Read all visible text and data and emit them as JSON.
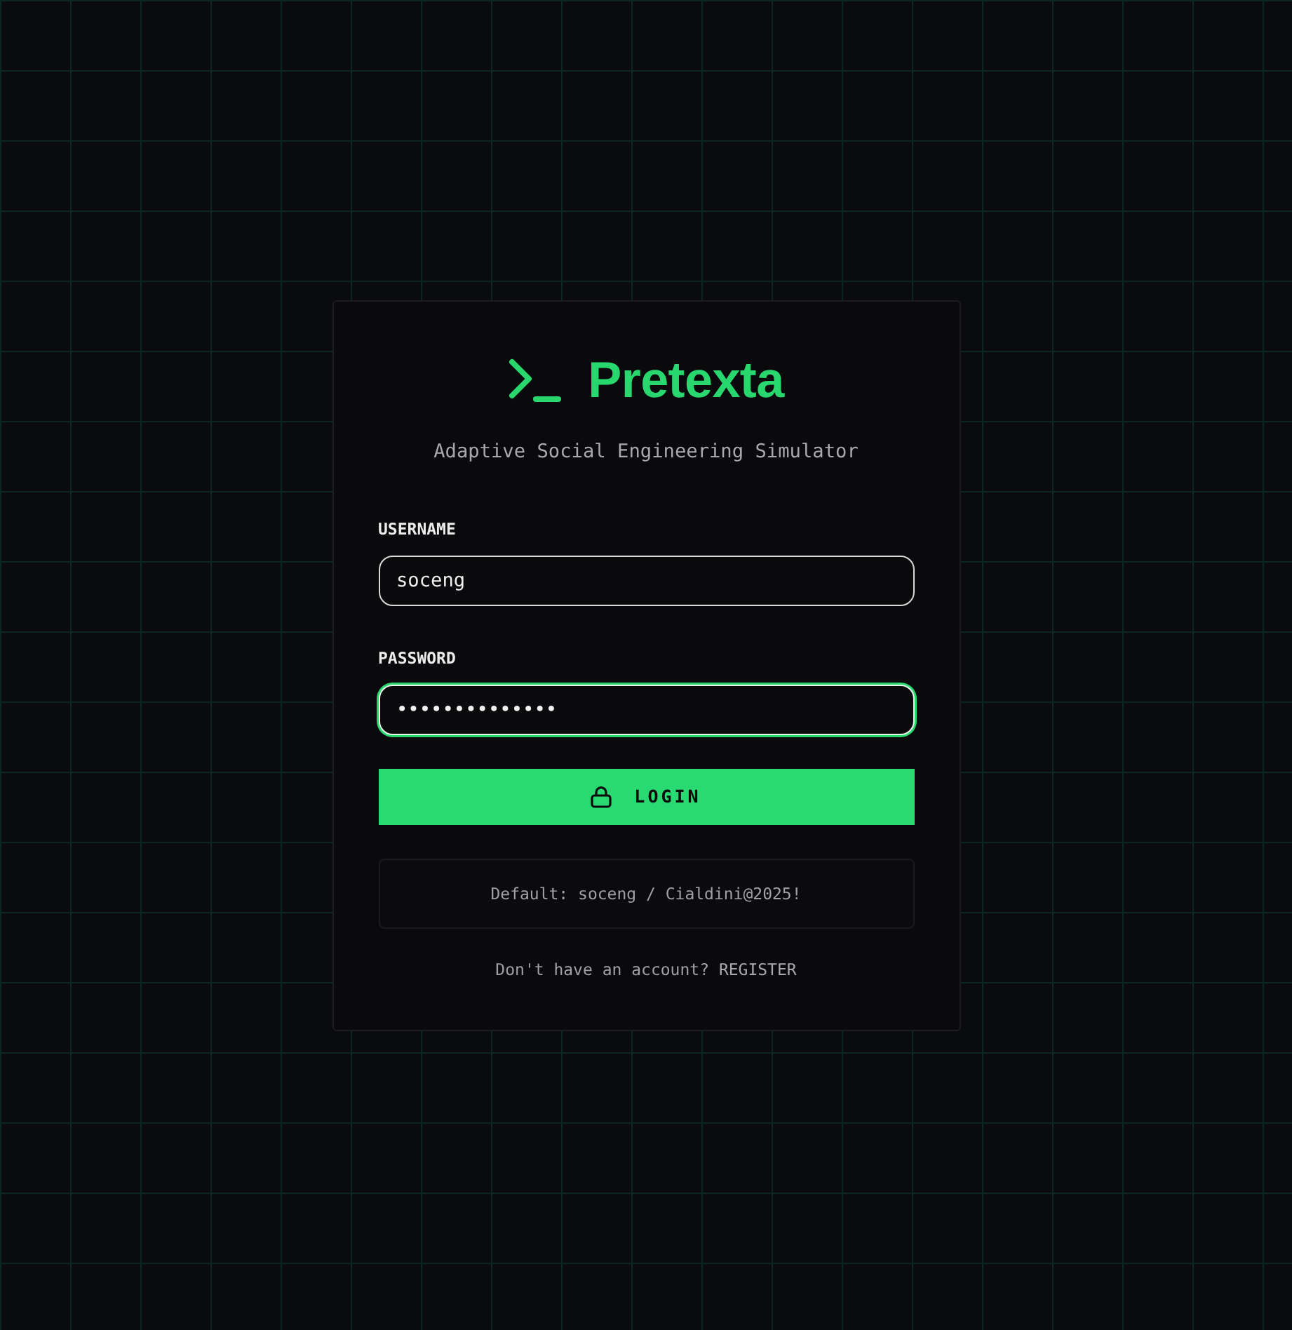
{
  "brand": {
    "name": "Pretexta",
    "tagline": "Adaptive Social Engineering Simulator"
  },
  "fields": [
    {
      "label": "USERNAME",
      "value": "soceng",
      "focused": false
    },
    {
      "label": "PASSWORD",
      "value": "••••••••••••••",
      "focused": true
    }
  ],
  "login_button": {
    "label": "LOGIN"
  },
  "default_hint": "Default: soceng / Cialdini@2025!",
  "register_prompt": {
    "text": "Don't have an account?",
    "link": "REGISTER"
  }
}
